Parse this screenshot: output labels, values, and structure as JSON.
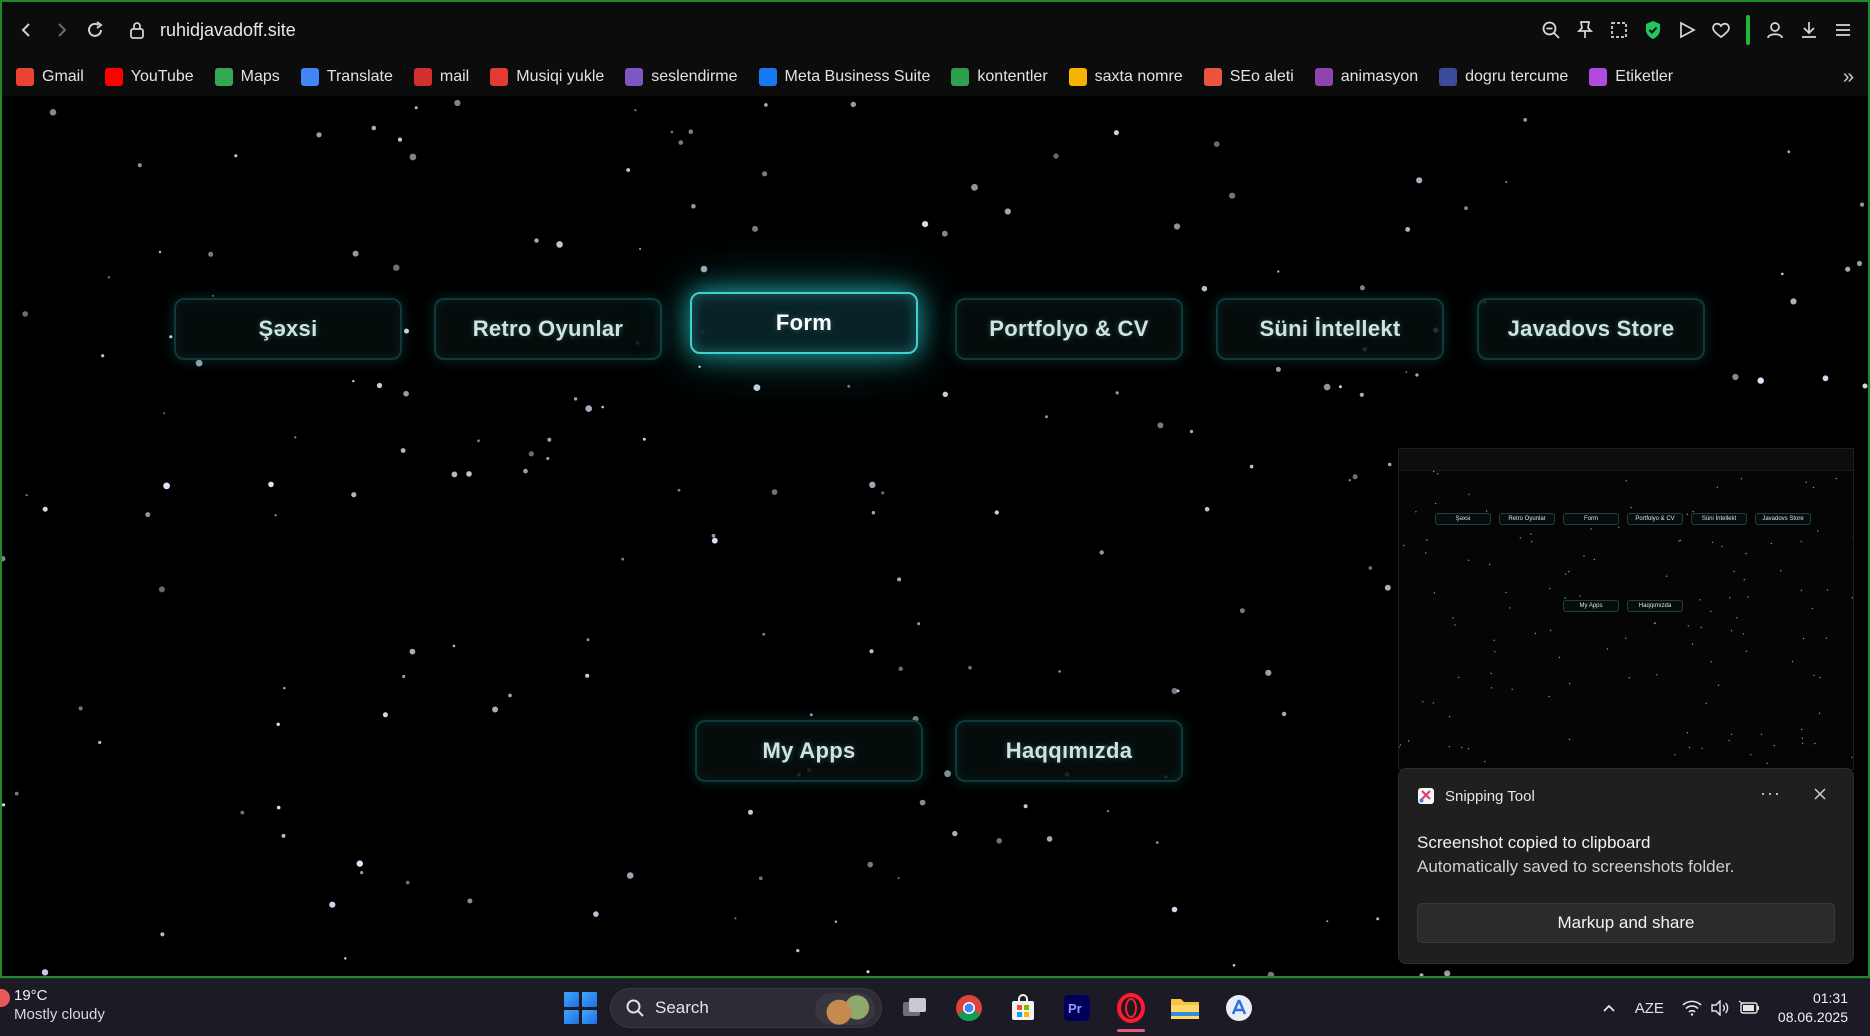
{
  "browser": {
    "url": "ruhidjavadoff.site",
    "bookmarks": [
      {
        "label": "Gmail",
        "icon": "gmail-icon",
        "color": "#ea4335"
      },
      {
        "label": "YouTube",
        "icon": "youtube-icon",
        "color": "#ff0000"
      },
      {
        "label": "Maps",
        "icon": "maps-icon",
        "color": "#34a853"
      },
      {
        "label": "Translate",
        "icon": "translate-icon",
        "color": "#4285f4"
      },
      {
        "label": "mail",
        "icon": "mail-icon",
        "color": "#d32f2f"
      },
      {
        "label": "Musiqi yukle",
        "icon": "music-icon",
        "color": "#e53935"
      },
      {
        "label": "seslendirme",
        "icon": "voice-icon",
        "color": "#7e57c2"
      },
      {
        "label": "Meta Business Suite",
        "icon": "meta-icon",
        "color": "#1877f2"
      },
      {
        "label": "kontentler",
        "icon": "px-icon",
        "color": "#2e9e4f"
      },
      {
        "label": "saxta nomre",
        "icon": "smile-icon",
        "color": "#f4b400"
      },
      {
        "label": "SEo aleti",
        "icon": "seo-icon",
        "color": "#e8553e"
      },
      {
        "label": "animasyon",
        "icon": "animation-icon",
        "color": "#8e44ad"
      },
      {
        "label": "dogru tercume",
        "icon": "arrow-icon",
        "color": "#3b4a9b"
      },
      {
        "label": "Etiketler",
        "icon": "tag-icon",
        "color": "#b04be0"
      }
    ]
  },
  "page": {
    "menu_top": [
      "Şəxsi",
      "Retro Oyunlar",
      "Form",
      "Portfolyo & CV",
      "Süni İntellekt",
      "Javadovs Store"
    ],
    "menu_bottom": [
      "My Apps",
      "Haqqımızda"
    ],
    "active_item": "Form",
    "accent_color": "#3fd0d0"
  },
  "notification": {
    "app": "Snipping Tool",
    "title": "Screenshot copied to clipboard",
    "body": "Automatically saved to screenshots folder.",
    "action": "Markup and share"
  },
  "taskbar": {
    "weather_temp": "19°C",
    "weather_desc": "Mostly cloudy",
    "search_placeholder": "Search",
    "language": "AZE",
    "time": "01:31",
    "date": "08.06.2025"
  }
}
